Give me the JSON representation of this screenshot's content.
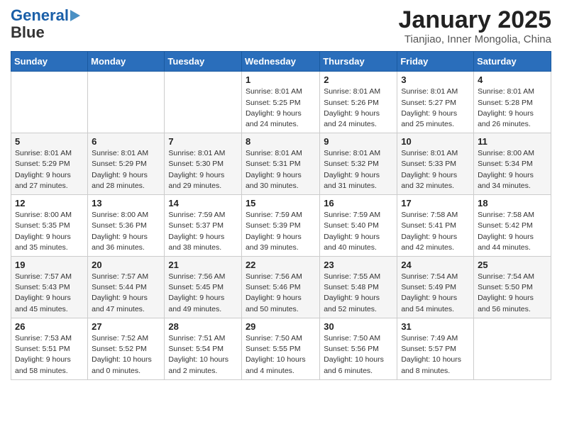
{
  "header": {
    "logo_line1": "General",
    "logo_line2": "Blue",
    "title": "January 2025",
    "subtitle": "Tianjiao, Inner Mongolia, China"
  },
  "columns": [
    "Sunday",
    "Monday",
    "Tuesday",
    "Wednesday",
    "Thursday",
    "Friday",
    "Saturday"
  ],
  "weeks": [
    [
      {
        "day": "",
        "info": ""
      },
      {
        "day": "",
        "info": ""
      },
      {
        "day": "",
        "info": ""
      },
      {
        "day": "1",
        "info": "Sunrise: 8:01 AM\nSunset: 5:25 PM\nDaylight: 9 hours\nand 24 minutes."
      },
      {
        "day": "2",
        "info": "Sunrise: 8:01 AM\nSunset: 5:26 PM\nDaylight: 9 hours\nand 24 minutes."
      },
      {
        "day": "3",
        "info": "Sunrise: 8:01 AM\nSunset: 5:27 PM\nDaylight: 9 hours\nand 25 minutes."
      },
      {
        "day": "4",
        "info": "Sunrise: 8:01 AM\nSunset: 5:28 PM\nDaylight: 9 hours\nand 26 minutes."
      }
    ],
    [
      {
        "day": "5",
        "info": "Sunrise: 8:01 AM\nSunset: 5:29 PM\nDaylight: 9 hours\nand 27 minutes."
      },
      {
        "day": "6",
        "info": "Sunrise: 8:01 AM\nSunset: 5:29 PM\nDaylight: 9 hours\nand 28 minutes."
      },
      {
        "day": "7",
        "info": "Sunrise: 8:01 AM\nSunset: 5:30 PM\nDaylight: 9 hours\nand 29 minutes."
      },
      {
        "day": "8",
        "info": "Sunrise: 8:01 AM\nSunset: 5:31 PM\nDaylight: 9 hours\nand 30 minutes."
      },
      {
        "day": "9",
        "info": "Sunrise: 8:01 AM\nSunset: 5:32 PM\nDaylight: 9 hours\nand 31 minutes."
      },
      {
        "day": "10",
        "info": "Sunrise: 8:01 AM\nSunset: 5:33 PM\nDaylight: 9 hours\nand 32 minutes."
      },
      {
        "day": "11",
        "info": "Sunrise: 8:00 AM\nSunset: 5:34 PM\nDaylight: 9 hours\nand 34 minutes."
      }
    ],
    [
      {
        "day": "12",
        "info": "Sunrise: 8:00 AM\nSunset: 5:35 PM\nDaylight: 9 hours\nand 35 minutes."
      },
      {
        "day": "13",
        "info": "Sunrise: 8:00 AM\nSunset: 5:36 PM\nDaylight: 9 hours\nand 36 minutes."
      },
      {
        "day": "14",
        "info": "Sunrise: 7:59 AM\nSunset: 5:37 PM\nDaylight: 9 hours\nand 38 minutes."
      },
      {
        "day": "15",
        "info": "Sunrise: 7:59 AM\nSunset: 5:39 PM\nDaylight: 9 hours\nand 39 minutes."
      },
      {
        "day": "16",
        "info": "Sunrise: 7:59 AM\nSunset: 5:40 PM\nDaylight: 9 hours\nand 40 minutes."
      },
      {
        "day": "17",
        "info": "Sunrise: 7:58 AM\nSunset: 5:41 PM\nDaylight: 9 hours\nand 42 minutes."
      },
      {
        "day": "18",
        "info": "Sunrise: 7:58 AM\nSunset: 5:42 PM\nDaylight: 9 hours\nand 44 minutes."
      }
    ],
    [
      {
        "day": "19",
        "info": "Sunrise: 7:57 AM\nSunset: 5:43 PM\nDaylight: 9 hours\nand 45 minutes."
      },
      {
        "day": "20",
        "info": "Sunrise: 7:57 AM\nSunset: 5:44 PM\nDaylight: 9 hours\nand 47 minutes."
      },
      {
        "day": "21",
        "info": "Sunrise: 7:56 AM\nSunset: 5:45 PM\nDaylight: 9 hours\nand 49 minutes."
      },
      {
        "day": "22",
        "info": "Sunrise: 7:56 AM\nSunset: 5:46 PM\nDaylight: 9 hours\nand 50 minutes."
      },
      {
        "day": "23",
        "info": "Sunrise: 7:55 AM\nSunset: 5:48 PM\nDaylight: 9 hours\nand 52 minutes."
      },
      {
        "day": "24",
        "info": "Sunrise: 7:54 AM\nSunset: 5:49 PM\nDaylight: 9 hours\nand 54 minutes."
      },
      {
        "day": "25",
        "info": "Sunrise: 7:54 AM\nSunset: 5:50 PM\nDaylight: 9 hours\nand 56 minutes."
      }
    ],
    [
      {
        "day": "26",
        "info": "Sunrise: 7:53 AM\nSunset: 5:51 PM\nDaylight: 9 hours\nand 58 minutes."
      },
      {
        "day": "27",
        "info": "Sunrise: 7:52 AM\nSunset: 5:52 PM\nDaylight: 10 hours\nand 0 minutes."
      },
      {
        "day": "28",
        "info": "Sunrise: 7:51 AM\nSunset: 5:54 PM\nDaylight: 10 hours\nand 2 minutes."
      },
      {
        "day": "29",
        "info": "Sunrise: 7:50 AM\nSunset: 5:55 PM\nDaylight: 10 hours\nand 4 minutes."
      },
      {
        "day": "30",
        "info": "Sunrise: 7:50 AM\nSunset: 5:56 PM\nDaylight: 10 hours\nand 6 minutes."
      },
      {
        "day": "31",
        "info": "Sunrise: 7:49 AM\nSunset: 5:57 PM\nDaylight: 10 hours\nand 8 minutes."
      },
      {
        "day": "",
        "info": ""
      }
    ]
  ]
}
